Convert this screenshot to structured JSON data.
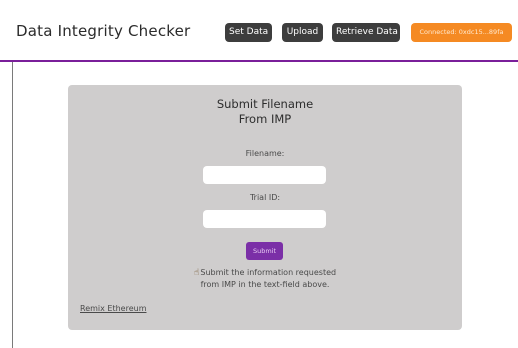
{
  "header": {
    "title": "Data Integrity Checker",
    "buttons": {
      "set_data": "Set Data",
      "upload": "Upload",
      "retrieve_data": "Retrieve Data"
    },
    "connection_status": "Connected: 0xdc15...89fa"
  },
  "form": {
    "heading_line1": "Submit Filename",
    "heading_line2": "From IMP",
    "filename_label": "Filename:",
    "filename_value": "",
    "trial_label": "Trial ID:",
    "trial_value": "",
    "submit_label": "Submit",
    "info_icon": "pointing-hand-icon",
    "info_text": "Submit the information requested from IMP in the text-field above.",
    "footer_link": "Remix Ethereum"
  },
  "colors": {
    "accent_purple": "#7b2fa7",
    "nav_divider": "#7a1f9a",
    "connected_orange": "#f58a23",
    "nav_button_bg": "#3d3d3d",
    "card_bg": "#cfcdcd"
  }
}
